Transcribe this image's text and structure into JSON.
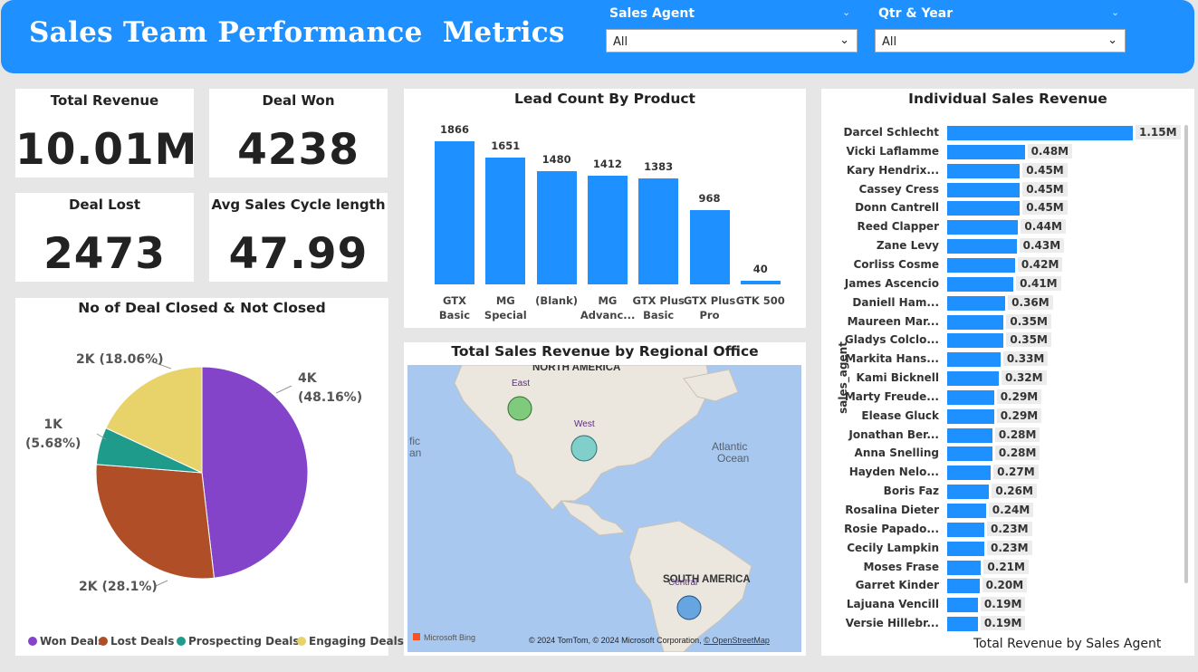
{
  "header": {
    "title": "Sales Team Performance  Metrics",
    "slicers": [
      {
        "label": "Sales Agent",
        "value": "All"
      },
      {
        "label": "Qtr & Year",
        "value": "All"
      }
    ]
  },
  "kpis": [
    {
      "title": "Total Revenue",
      "value": "10.01M"
    },
    {
      "title": "Deal Won",
      "value": "4238"
    },
    {
      "title": "Deal Lost",
      "value": "2473"
    },
    {
      "title": "Avg Sales Cycle length",
      "value": "47.99"
    }
  ],
  "lead_chart": {
    "title": "Lead Count By Product"
  },
  "pie_chart": {
    "title": "No of Deal Closed & Not Closed",
    "labels": [
      "4K",
      "(48.16%)",
      "2K (28.1%)",
      "1K",
      "(5.68%)",
      "2K (18.06%)"
    ]
  },
  "map": {
    "title": "Total Sales Revenue by Regional Office",
    "labels": {
      "north_america": "NORTH AMERICA",
      "south_america": "SOUTH AMERICA",
      "atlantic_1": "Atlantic",
      "atlantic_2": "Ocean",
      "pacific_1": "fic",
      "pacific_2": "an",
      "east": "East",
      "west": "West",
      "central": "Central"
    },
    "bing": "Microsoft Bing",
    "copyright": "© 2024 TomTom, © 2024 Microsoft Corporation, ",
    "osm": "© OpenStreetMap",
    "colors": {
      "water": "#a9c8f0",
      "land": "#ebe7df",
      "east": "#6cc46c",
      "west": "#6fcac7",
      "central": "#3a8fe0"
    }
  },
  "revenue_chart": {
    "title": "Individual Sales Revenue",
    "ylabel": "sales_agent",
    "xlabel": "Total Revenue by Sales Agent"
  },
  "chart_data": [
    {
      "type": "bar",
      "title": "Lead Count By Product",
      "categories": [
        "GTX Basic",
        "MG Special",
        "(Blank)",
        "MG Advanc...",
        "GTX Plus Basic",
        "GTX Plus Pro",
        "GTK 500"
      ],
      "category_lines": [
        [
          "GTX Basic"
        ],
        [
          "MG",
          "Special"
        ],
        [
          "(Blank)"
        ],
        [
          "MG",
          "Advanc..."
        ],
        [
          "GTX Plus",
          "Basic"
        ],
        [
          "GTX Plus",
          "Pro"
        ],
        [
          "GTK 500"
        ]
      ],
      "values": [
        1866,
        1651,
        1480,
        1412,
        1383,
        968,
        40
      ],
      "color": "#1e90ff"
    },
    {
      "type": "pie",
      "title": "No of Deal Closed & Not Closed",
      "slices": [
        {
          "name": "Won Deals",
          "value": 48.16,
          "color": "#8444c9"
        },
        {
          "name": "Lost Deals",
          "value": 28.1,
          "color": "#b04f27"
        },
        {
          "name": "Prospecting Deals",
          "value": 5.68,
          "color": "#1e9b8a"
        },
        {
          "name": "Engaging Deals",
          "value": 18.06,
          "color": "#e8d26a"
        }
      ],
      "legend": "bottom"
    },
    {
      "type": "bar",
      "orientation": "horizontal",
      "title": "Individual Sales Revenue",
      "ylabel": "sales_agent",
      "xlabel": "Total Revenue by Sales Agent",
      "categories": [
        "Darcel Schlecht",
        "Vicki Laflamme",
        "Kary Hendrix...",
        "Cassey Cress",
        "Donn Cantrell",
        "Reed Clapper",
        "Zane Levy",
        "Corliss Cosme",
        "James Ascencio",
        "Daniell Ham...",
        "Maureen Mar...",
        "Gladys Colclo...",
        "Markita Hans...",
        "Kami Bicknell",
        "Marty Freude...",
        "Elease Gluck",
        "Jonathan Ber...",
        "Anna Snelling",
        "Hayden Nelo...",
        "Boris Faz",
        "Rosalina Dieter",
        "Rosie Papado...",
        "Cecily Lampkin",
        "Moses Frase",
        "Garret Kinder",
        "Lajuana Vencill",
        "Versie Hillebr..."
      ],
      "values": [
        1.15,
        0.48,
        0.45,
        0.45,
        0.45,
        0.44,
        0.43,
        0.42,
        0.41,
        0.36,
        0.35,
        0.35,
        0.33,
        0.32,
        0.29,
        0.29,
        0.28,
        0.28,
        0.27,
        0.26,
        0.24,
        0.23,
        0.23,
        0.21,
        0.2,
        0.19,
        0.19
      ],
      "labels": [
        "1.15M",
        "0.48M",
        "0.45M",
        "0.45M",
        "0.45M",
        "0.44M",
        "0.43M",
        "0.42M",
        "0.41M",
        "0.36M",
        "0.35M",
        "0.35M",
        "0.33M",
        "0.32M",
        "0.29M",
        "0.29M",
        "0.28M",
        "0.28M",
        "0.27M",
        "0.26M",
        "0.24M",
        "0.23M",
        "0.23M",
        "0.21M",
        "0.20M",
        "0.19M",
        "0.19M"
      ],
      "unit": "M",
      "color": "#1e90ff"
    }
  ]
}
